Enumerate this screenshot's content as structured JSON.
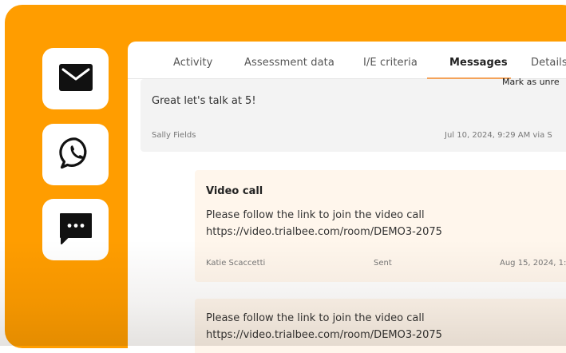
{
  "channels": [
    {
      "name": "email",
      "icon": "envelope-icon"
    },
    {
      "name": "whatsapp",
      "icon": "whatsapp-icon"
    },
    {
      "name": "sms",
      "icon": "chat-bubble-icon"
    }
  ],
  "tabs": [
    {
      "label": "Activity",
      "active": false
    },
    {
      "label": "Assessment data",
      "active": false
    },
    {
      "label": "I/E criteria",
      "active": false
    },
    {
      "label": "Messages",
      "active": true
    },
    {
      "label": "Details",
      "active": false
    }
  ],
  "mark_unread_label": "Mark as unre",
  "messages": [
    {
      "text": "Great let's talk at 5!",
      "sender": "Sally Fields",
      "date": "Jul 10, 2024, 9:29 AM via S"
    },
    {
      "title": "Video call",
      "line1": "Please follow the link to join the video call",
      "line2": "https://video.trialbee.com/room/DEMO3-2075",
      "sender": "Katie Scaccetti",
      "status": "Sent",
      "date": "Aug 15, 2024, 1:"
    },
    {
      "line1": "Please follow the link to join the video call",
      "line2": "https://video.trialbee.com/room/DEMO3-2075"
    }
  ],
  "colors": {
    "accent": "#ff9d00",
    "tab_underline": "#f4a35a",
    "card_gray": "#f3f3f3",
    "card_peach": "#fff6ec"
  }
}
